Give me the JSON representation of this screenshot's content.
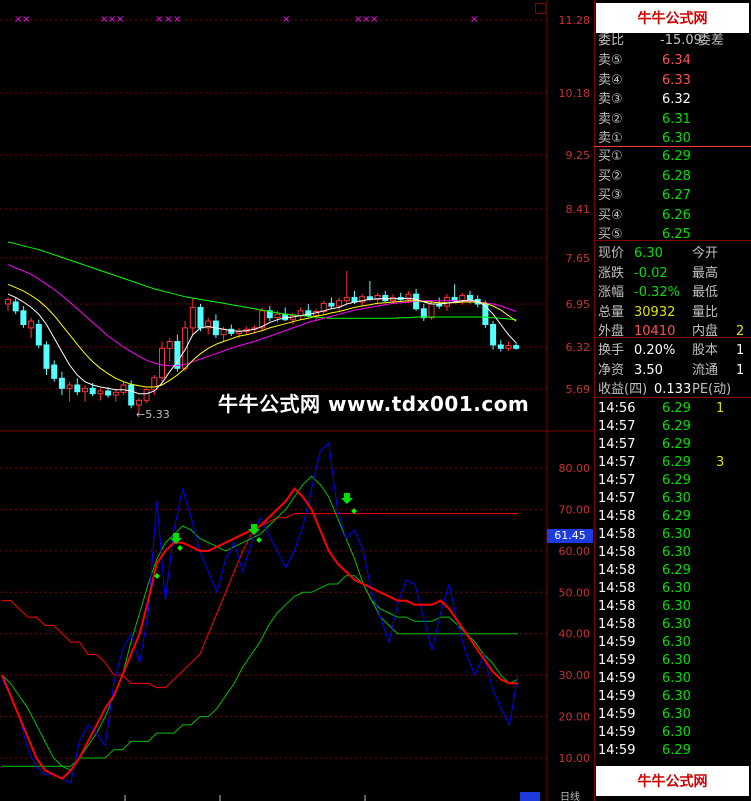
{
  "price_axis": [
    "11.28",
    "10.18",
    "9.25",
    "8.41",
    "7.65",
    "6.95",
    "6.32",
    "5.69"
  ],
  "indicator_axis": [
    "80.00",
    "70.00",
    "60.00",
    "50.00",
    "40.00",
    "30.00",
    "20.00",
    "10.00"
  ],
  "low_marker": "←5.33",
  "current_tag": "61.45",
  "watermark": "牛牛公式网 www.tdx001.com",
  "logo_text": "牛牛公式网",
  "logo_url": "www.tdx001.com",
  "bottom_tab": "日线",
  "order_book": {
    "header_left": "委比",
    "header_mid": "-15.09",
    "header_right": "委差",
    "sell": [
      {
        "label": "卖⑤",
        "price": "6.34"
      },
      {
        "label": "卖④",
        "price": "6.33"
      },
      {
        "label": "卖③",
        "price": "6.32"
      },
      {
        "label": "卖②",
        "price": "6.31"
      },
      {
        "label": "卖①",
        "price": "6.30"
      }
    ],
    "buy": [
      {
        "label": "买①",
        "price": "6.29"
      },
      {
        "label": "买②",
        "price": "6.28"
      },
      {
        "label": "买③",
        "price": "6.27"
      },
      {
        "label": "买④",
        "price": "6.26"
      },
      {
        "label": "买⑤",
        "price": "6.25"
      }
    ]
  },
  "quote": [
    {
      "label": "现价",
      "value": "6.30",
      "label2": "今开"
    },
    {
      "label": "涨跌",
      "value": "-0.02",
      "label2": "最高"
    },
    {
      "label": "涨幅",
      "value": "-0.32%",
      "label2": "最低"
    },
    {
      "label": "总量",
      "value": "30932",
      "label2": "量比"
    },
    {
      "label": "外盘",
      "value": "10410",
      "label2": "内盘",
      "value2": "2"
    }
  ],
  "fundamentals": [
    {
      "label": "换手",
      "value": "0.20%",
      "label2": "股本",
      "value2": "1"
    },
    {
      "label": "净资",
      "value": "3.50",
      "label2": "流通",
      "value2": "1"
    },
    {
      "label": "收益(四)",
      "value": "0.133",
      "label2": "PE(动)",
      "value2": ""
    }
  ],
  "ticks": [
    {
      "time": "14:56",
      "price": "6.29",
      "extra": "1"
    },
    {
      "time": "14:57",
      "price": "6.29",
      "extra": ""
    },
    {
      "time": "14:57",
      "price": "6.29",
      "extra": ""
    },
    {
      "time": "14:57",
      "price": "6.29",
      "extra": "3"
    },
    {
      "time": "14:57",
      "price": "6.29",
      "extra": ""
    },
    {
      "time": "14:57",
      "price": "6.30",
      "extra": ""
    },
    {
      "time": "14:58",
      "price": "6.29",
      "extra": ""
    },
    {
      "time": "14:58",
      "price": "6.30",
      "extra": ""
    },
    {
      "time": "14:58",
      "price": "6.30",
      "extra": ""
    },
    {
      "time": "14:58",
      "price": "6.29",
      "extra": ""
    },
    {
      "time": "14:58",
      "price": "6.30",
      "extra": ""
    },
    {
      "time": "14:58",
      "price": "6.30",
      "extra": ""
    },
    {
      "time": "14:58",
      "price": "6.30",
      "extra": ""
    },
    {
      "time": "14:59",
      "price": "6.30",
      "extra": ""
    },
    {
      "time": "14:59",
      "price": "6.30",
      "extra": ""
    },
    {
      "time": "14:59",
      "price": "6.30",
      "extra": ""
    },
    {
      "time": "14:59",
      "price": "6.30",
      "extra": ""
    },
    {
      "time": "14:59",
      "price": "6.30",
      "extra": ""
    },
    {
      "time": "14:59",
      "price": "6.30",
      "extra": ""
    },
    {
      "time": "14:59",
      "price": "6.29",
      "extra": ""
    }
  ],
  "colors": {
    "up_candle": "#ff3232",
    "down_candle": "#54ffff",
    "ma_white": "#ffffff",
    "ma_yellow": "#ffff00",
    "ma_magenta": "#ff00ff",
    "ma_green": "#00ff00",
    "ind_blue": "#0000ff",
    "ind_red": "#ff0000",
    "ind_green": "#00c000",
    "grid": "#800000"
  },
  "candles": [
    {
      "o": 6.95,
      "h": 7.05,
      "l": 6.85,
      "c": 7.02
    },
    {
      "o": 6.98,
      "h": 7.05,
      "l": 6.8,
      "c": 6.85
    },
    {
      "o": 6.85,
      "h": 6.92,
      "l": 6.6,
      "c": 6.65
    },
    {
      "o": 6.6,
      "h": 6.75,
      "l": 6.45,
      "c": 6.7
    },
    {
      "o": 6.65,
      "h": 6.72,
      "l": 6.3,
      "c": 6.35
    },
    {
      "o": 6.35,
      "h": 6.4,
      "l": 5.9,
      "c": 6.0
    },
    {
      "o": 6.05,
      "h": 6.12,
      "l": 5.8,
      "c": 5.85
    },
    {
      "o": 5.85,
      "h": 5.95,
      "l": 5.6,
      "c": 5.7
    },
    {
      "o": 5.7,
      "h": 5.8,
      "l": 5.5,
      "c": 5.75
    },
    {
      "o": 5.75,
      "h": 5.85,
      "l": 5.6,
      "c": 5.65
    },
    {
      "o": 5.65,
      "h": 5.75,
      "l": 5.5,
      "c": 5.7
    },
    {
      "o": 5.7,
      "h": 5.78,
      "l": 5.58,
      "c": 5.62
    },
    {
      "o": 5.62,
      "h": 5.7,
      "l": 5.52,
      "c": 5.66
    },
    {
      "o": 5.66,
      "h": 5.72,
      "l": 5.56,
      "c": 5.6
    },
    {
      "o": 5.6,
      "h": 5.68,
      "l": 5.5,
      "c": 5.64
    },
    {
      "o": 5.64,
      "h": 5.8,
      "l": 5.6,
      "c": 5.75
    },
    {
      "o": 5.75,
      "h": 5.82,
      "l": 5.4,
      "c": 5.45
    },
    {
      "o": 5.45,
      "h": 5.55,
      "l": 5.33,
      "c": 5.52
    },
    {
      "o": 5.52,
      "h": 5.7,
      "l": 5.48,
      "c": 5.68
    },
    {
      "o": 5.68,
      "h": 5.9,
      "l": 5.6,
      "c": 5.86
    },
    {
      "o": 5.86,
      "h": 6.4,
      "l": 5.8,
      "c": 6.3
    },
    {
      "o": 6.3,
      "h": 6.45,
      "l": 6.1,
      "c": 6.4
    },
    {
      "o": 6.4,
      "h": 6.5,
      "l": 5.95,
      "c": 6.0
    },
    {
      "o": 6.0,
      "h": 6.7,
      "l": 5.95,
      "c": 6.6
    },
    {
      "o": 6.6,
      "h": 7.05,
      "l": 6.5,
      "c": 6.9
    },
    {
      "o": 6.9,
      "h": 6.95,
      "l": 6.55,
      "c": 6.6
    },
    {
      "o": 6.6,
      "h": 6.75,
      "l": 6.5,
      "c": 6.7
    },
    {
      "o": 6.7,
      "h": 6.8,
      "l": 6.45,
      "c": 6.5
    },
    {
      "o": 6.5,
      "h": 6.62,
      "l": 6.4,
      "c": 6.58
    },
    {
      "o": 6.58,
      "h": 6.65,
      "l": 6.48,
      "c": 6.52
    },
    {
      "o": 6.52,
      "h": 6.6,
      "l": 6.45,
      "c": 6.55
    },
    {
      "o": 6.55,
      "h": 6.62,
      "l": 6.5,
      "c": 6.58
    },
    {
      "o": 6.58,
      "h": 6.64,
      "l": 6.52,
      "c": 6.6
    },
    {
      "o": 6.6,
      "h": 6.9,
      "l": 6.55,
      "c": 6.85
    },
    {
      "o": 6.85,
      "h": 6.92,
      "l": 6.7,
      "c": 6.75
    },
    {
      "o": 6.75,
      "h": 6.85,
      "l": 6.68,
      "c": 6.8
    },
    {
      "o": 6.8,
      "h": 6.9,
      "l": 6.7,
      "c": 6.72
    },
    {
      "o": 6.72,
      "h": 6.82,
      "l": 6.65,
      "c": 6.78
    },
    {
      "o": 6.78,
      "h": 6.9,
      "l": 6.72,
      "c": 6.85
    },
    {
      "o": 6.85,
      "h": 6.95,
      "l": 6.75,
      "c": 6.78
    },
    {
      "o": 6.78,
      "h": 6.88,
      "l": 6.7,
      "c": 6.84
    },
    {
      "o": 6.84,
      "h": 7.0,
      "l": 6.8,
      "c": 6.96
    },
    {
      "o": 6.96,
      "h": 7.05,
      "l": 6.88,
      "c": 6.92
    },
    {
      "o": 6.92,
      "h": 7.05,
      "l": 6.85,
      "c": 7.0
    },
    {
      "o": 7.0,
      "h": 7.45,
      "l": 6.95,
      "c": 7.05
    },
    {
      "o": 7.05,
      "h": 7.15,
      "l": 6.95,
      "c": 6.98
    },
    {
      "o": 6.98,
      "h": 7.1,
      "l": 6.92,
      "c": 7.06
    },
    {
      "o": 7.06,
      "h": 7.3,
      "l": 7.0,
      "c": 7.02
    },
    {
      "o": 7.02,
      "h": 7.12,
      "l": 6.94,
      "c": 7.08
    },
    {
      "o": 7.08,
      "h": 7.15,
      "l": 6.98,
      "c": 7.0
    },
    {
      "o": 7.0,
      "h": 7.1,
      "l": 6.95,
      "c": 7.05
    },
    {
      "o": 7.05,
      "h": 7.12,
      "l": 6.98,
      "c": 7.02
    },
    {
      "o": 7.02,
      "h": 7.15,
      "l": 6.96,
      "c": 7.1
    },
    {
      "o": 7.1,
      "h": 7.18,
      "l": 6.85,
      "c": 6.88
    },
    {
      "o": 6.88,
      "h": 6.95,
      "l": 6.7,
      "c": 6.75
    },
    {
      "o": 6.75,
      "h": 7.0,
      "l": 6.72,
      "c": 6.95
    },
    {
      "o": 6.95,
      "h": 7.05,
      "l": 6.88,
      "c": 6.92
    },
    {
      "o": 6.92,
      "h": 7.1,
      "l": 6.85,
      "c": 7.05
    },
    {
      "o": 7.05,
      "h": 7.25,
      "l": 6.98,
      "c": 7.0
    },
    {
      "o": 7.0,
      "h": 7.12,
      "l": 6.94,
      "c": 7.08
    },
    {
      "o": 7.08,
      "h": 7.15,
      "l": 6.96,
      "c": 7.02
    },
    {
      "o": 7.02,
      "h": 7.08,
      "l": 6.9,
      "c": 6.95
    },
    {
      "o": 6.95,
      "h": 7.0,
      "l": 6.6,
      "c": 6.65
    },
    {
      "o": 6.65,
      "h": 6.7,
      "l": 6.28,
      "c": 6.35
    },
    {
      "o": 6.35,
      "h": 6.42,
      "l": 6.25,
      "c": 6.3
    },
    {
      "o": 6.3,
      "h": 6.4,
      "l": 6.26,
      "c": 6.34
    },
    {
      "o": 6.34,
      "h": 6.38,
      "l": 6.28,
      "c": 6.3
    }
  ],
  "ma_fast": [
    7.1,
    7.05,
    6.98,
    6.9,
    6.8,
    6.65,
    6.45,
    6.25,
    6.05,
    5.9,
    5.8,
    5.75,
    5.72,
    5.7,
    5.68,
    5.68,
    5.66,
    5.62,
    5.62,
    5.66,
    5.78,
    5.95,
    6.1,
    6.28,
    6.5,
    6.6,
    6.62,
    6.6,
    6.58,
    6.56,
    6.55,
    6.56,
    6.58,
    6.62,
    6.68,
    6.72,
    6.75,
    6.76,
    6.78,
    6.8,
    6.82,
    6.85,
    6.88,
    6.9,
    6.95,
    6.98,
    7.0,
    7.02,
    7.03,
    7.03,
    7.03,
    7.03,
    7.04,
    7.02,
    6.98,
    6.95,
    6.95,
    6.96,
    6.98,
    7.0,
    7.01,
    6.99,
    6.92,
    6.8,
    6.65,
    6.5,
    6.38
  ],
  "ma_mid": [
    7.25,
    7.2,
    7.15,
    7.08,
    7.0,
    6.9,
    6.78,
    6.64,
    6.5,
    6.36,
    6.22,
    6.1,
    6.0,
    5.92,
    5.85,
    5.8,
    5.76,
    5.74,
    5.72,
    5.72,
    5.75,
    5.82,
    5.9,
    6.0,
    6.12,
    6.22,
    6.3,
    6.36,
    6.4,
    6.44,
    6.48,
    6.5,
    6.53,
    6.56,
    6.6,
    6.63,
    6.66,
    6.69,
    6.72,
    6.74,
    6.77,
    6.79,
    6.82,
    6.84,
    6.87,
    6.9,
    6.92,
    6.94,
    6.96,
    6.97,
    6.98,
    6.99,
    7.0,
    7.0,
    6.99,
    6.98,
    6.97,
    6.97,
    6.97,
    6.98,
    6.98,
    6.98,
    6.96,
    6.92,
    6.86,
    6.78,
    6.7
  ],
  "ma_slow": [
    7.55,
    7.5,
    7.45,
    7.4,
    7.33,
    7.25,
    7.17,
    7.08,
    6.98,
    6.88,
    6.78,
    6.68,
    6.58,
    6.48,
    6.4,
    6.32,
    6.25,
    6.18,
    6.12,
    6.08,
    6.05,
    6.04,
    6.04,
    6.06,
    6.1,
    6.14,
    6.18,
    6.22,
    6.26,
    6.3,
    6.34,
    6.37,
    6.4,
    6.44,
    6.48,
    6.52,
    6.56,
    6.6,
    6.64,
    6.68,
    6.71,
    6.74,
    6.77,
    6.8,
    6.83,
    6.86,
    6.88,
    6.9,
    6.92,
    6.94,
    6.96,
    6.97,
    6.98,
    6.99,
    7.0,
    7.0,
    7.0,
    7.0,
    7.0,
    6.99,
    6.99,
    6.98,
    6.97,
    6.95,
    6.92,
    6.88,
    6.84
  ],
  "ma_long": [
    7.9,
    7.87,
    7.84,
    7.81,
    7.78,
    7.74,
    7.7,
    7.66,
    7.62,
    7.58,
    7.54,
    7.5,
    7.46,
    7.42,
    7.38,
    7.34,
    7.3,
    7.26,
    7.22,
    7.18,
    7.15,
    7.12,
    7.09,
    7.06,
    7.04,
    7.02,
    7.0,
    6.98,
    6.96,
    6.94,
    6.92,
    6.9,
    6.88,
    6.86,
    6.84,
    6.82,
    6.8,
    6.79,
    6.78,
    6.77,
    6.76,
    6.75,
    6.74,
    6.74,
    6.74,
    6.74,
    6.74,
    6.74,
    6.74,
    6.74,
    6.74,
    6.75,
    6.75,
    6.76,
    6.76,
    6.76,
    6.76,
    6.76,
    6.76,
    6.76,
    6.76,
    6.76,
    6.76,
    6.75,
    6.74,
    6.73,
    6.72
  ],
  "ind_blue": [
    29,
    25,
    20,
    12,
    8,
    6,
    6,
    5,
    4,
    14,
    18,
    16,
    13,
    28,
    36,
    40,
    33,
    45,
    72,
    48,
    65,
    75,
    68,
    60,
    55,
    50,
    58,
    62,
    55,
    62,
    68,
    64,
    60,
    56,
    60,
    66,
    75,
    84,
    86,
    70,
    63,
    65,
    60,
    50,
    44,
    38,
    47,
    53,
    52,
    44,
    36,
    45,
    52,
    42,
    35,
    30,
    35,
    27,
    22,
    18,
    30
  ],
  "ind_red": [
    30,
    25,
    20,
    15,
    10,
    7,
    6,
    5,
    7,
    10,
    14,
    18,
    22,
    25,
    30,
    35,
    40,
    48,
    57,
    60,
    62,
    62,
    61,
    60,
    60,
    61,
    62,
    63,
    64,
    65,
    66,
    68,
    70,
    72,
    75,
    73,
    70,
    65,
    60,
    57,
    55,
    53,
    52,
    51,
    50,
    49,
    48,
    48,
    47,
    47,
    47,
    48,
    46,
    43,
    40,
    37,
    34,
    31,
    29,
    28,
    28
  ],
  "ind_green": [
    30,
    28,
    25,
    22,
    18,
    14,
    10,
    8,
    7,
    10,
    13,
    16,
    20,
    25,
    30,
    38,
    45,
    52,
    58,
    62,
    64,
    66,
    65,
    63,
    62,
    61,
    60,
    61,
    62,
    63,
    64,
    66,
    68,
    70,
    73,
    76,
    78,
    76,
    73,
    68,
    63,
    58,
    52,
    48,
    46,
    45,
    44,
    44,
    43,
    43,
    43,
    44,
    44,
    42,
    40,
    38,
    35,
    33,
    30,
    28,
    29
  ],
  "ind_red_step": [
    48,
    48,
    46,
    44,
    44,
    42,
    42,
    40,
    38,
    38,
    35,
    35,
    33,
    30,
    30,
    28,
    28,
    28,
    27,
    27,
    29,
    31,
    33,
    35,
    40,
    45,
    50,
    55,
    60,
    64,
    66,
    67,
    68,
    68,
    69,
    69,
    69,
    69,
    69,
    69,
    69,
    69,
    69,
    69,
    69,
    69,
    69,
    69,
    69,
    69,
    69,
    69,
    69,
    69,
    69,
    69,
    69,
    69,
    69,
    69,
    69
  ],
  "ind_green_step": [
    8,
    8,
    8,
    8,
    8,
    8,
    8,
    8,
    8,
    10,
    10,
    10,
    10,
    12,
    12,
    14,
    14,
    14,
    16,
    16,
    16,
    18,
    18,
    20,
    20,
    22,
    25,
    28,
    32,
    35,
    38,
    42,
    45,
    47,
    49,
    50,
    50,
    51,
    52,
    52,
    54,
    54,
    52,
    48,
    44,
    42,
    40,
    40,
    40,
    40,
    40,
    40,
    40,
    40,
    40,
    40,
    40,
    40,
    40,
    40,
    40
  ]
}
